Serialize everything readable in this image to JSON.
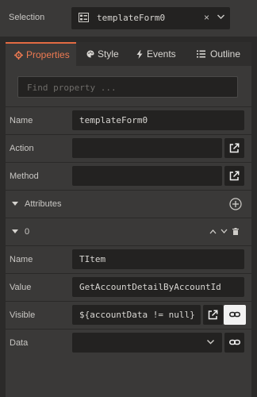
{
  "selection": {
    "label": "Selection",
    "value": "templateForm0",
    "icon": "form-icon",
    "clear_glyph": "×"
  },
  "tabs": [
    {
      "label": "Properties",
      "icon": "gear-icon",
      "active": true
    },
    {
      "label": "Style",
      "icon": "palette-icon",
      "active": false
    },
    {
      "label": "Events",
      "icon": "bolt-icon",
      "active": false
    },
    {
      "label": "Outline",
      "icon": "list-icon",
      "active": false
    }
  ],
  "search": {
    "placeholder": "Find property ..."
  },
  "properties": {
    "name": {
      "label": "Name",
      "value": "templateForm0"
    },
    "action": {
      "label": "Action",
      "value": ""
    },
    "method": {
      "label": "Method",
      "value": ""
    }
  },
  "attributes": {
    "label": "Attributes",
    "item": {
      "index_label": "0",
      "name": {
        "label": "Name",
        "value": "TItem"
      },
      "value": {
        "label": "Value",
        "value": "GetAccountDetailByAccountId"
      },
      "visible": {
        "label": "Visible",
        "value": "${accountData != null}"
      },
      "data": {
        "label": "Data",
        "value": ""
      }
    }
  },
  "colors": {
    "accent": "#e36b43",
    "panel": "#3a3938",
    "field": "#232221",
    "background": "#2b2a29"
  }
}
